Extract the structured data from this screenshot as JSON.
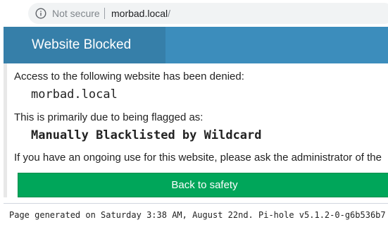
{
  "browser": {
    "security_label": "Not secure",
    "url_host": "morbad.local",
    "url_path": "/"
  },
  "header": {
    "title": "Website Blocked"
  },
  "content": {
    "denied_text": "Access to the following website has been denied:",
    "blocked_domain": "morbad.local",
    "flagged_text": "This is primarily due to being flagged as:",
    "flag_reason": "Manually Blacklisted by Wildcard",
    "contact_text": "If you have an ongoing use for this website, please ask the administrator of the"
  },
  "actions": {
    "back_label": "Back to safety"
  },
  "footer": {
    "text": "Page generated on Saturday 3:38 AM, August 22nd. Pi-hole v5.1.2-0-g6b536b7"
  },
  "colors": {
    "header": "#3c8dbc",
    "header_title_bg": "#367fa9",
    "button": "#00a65a"
  }
}
